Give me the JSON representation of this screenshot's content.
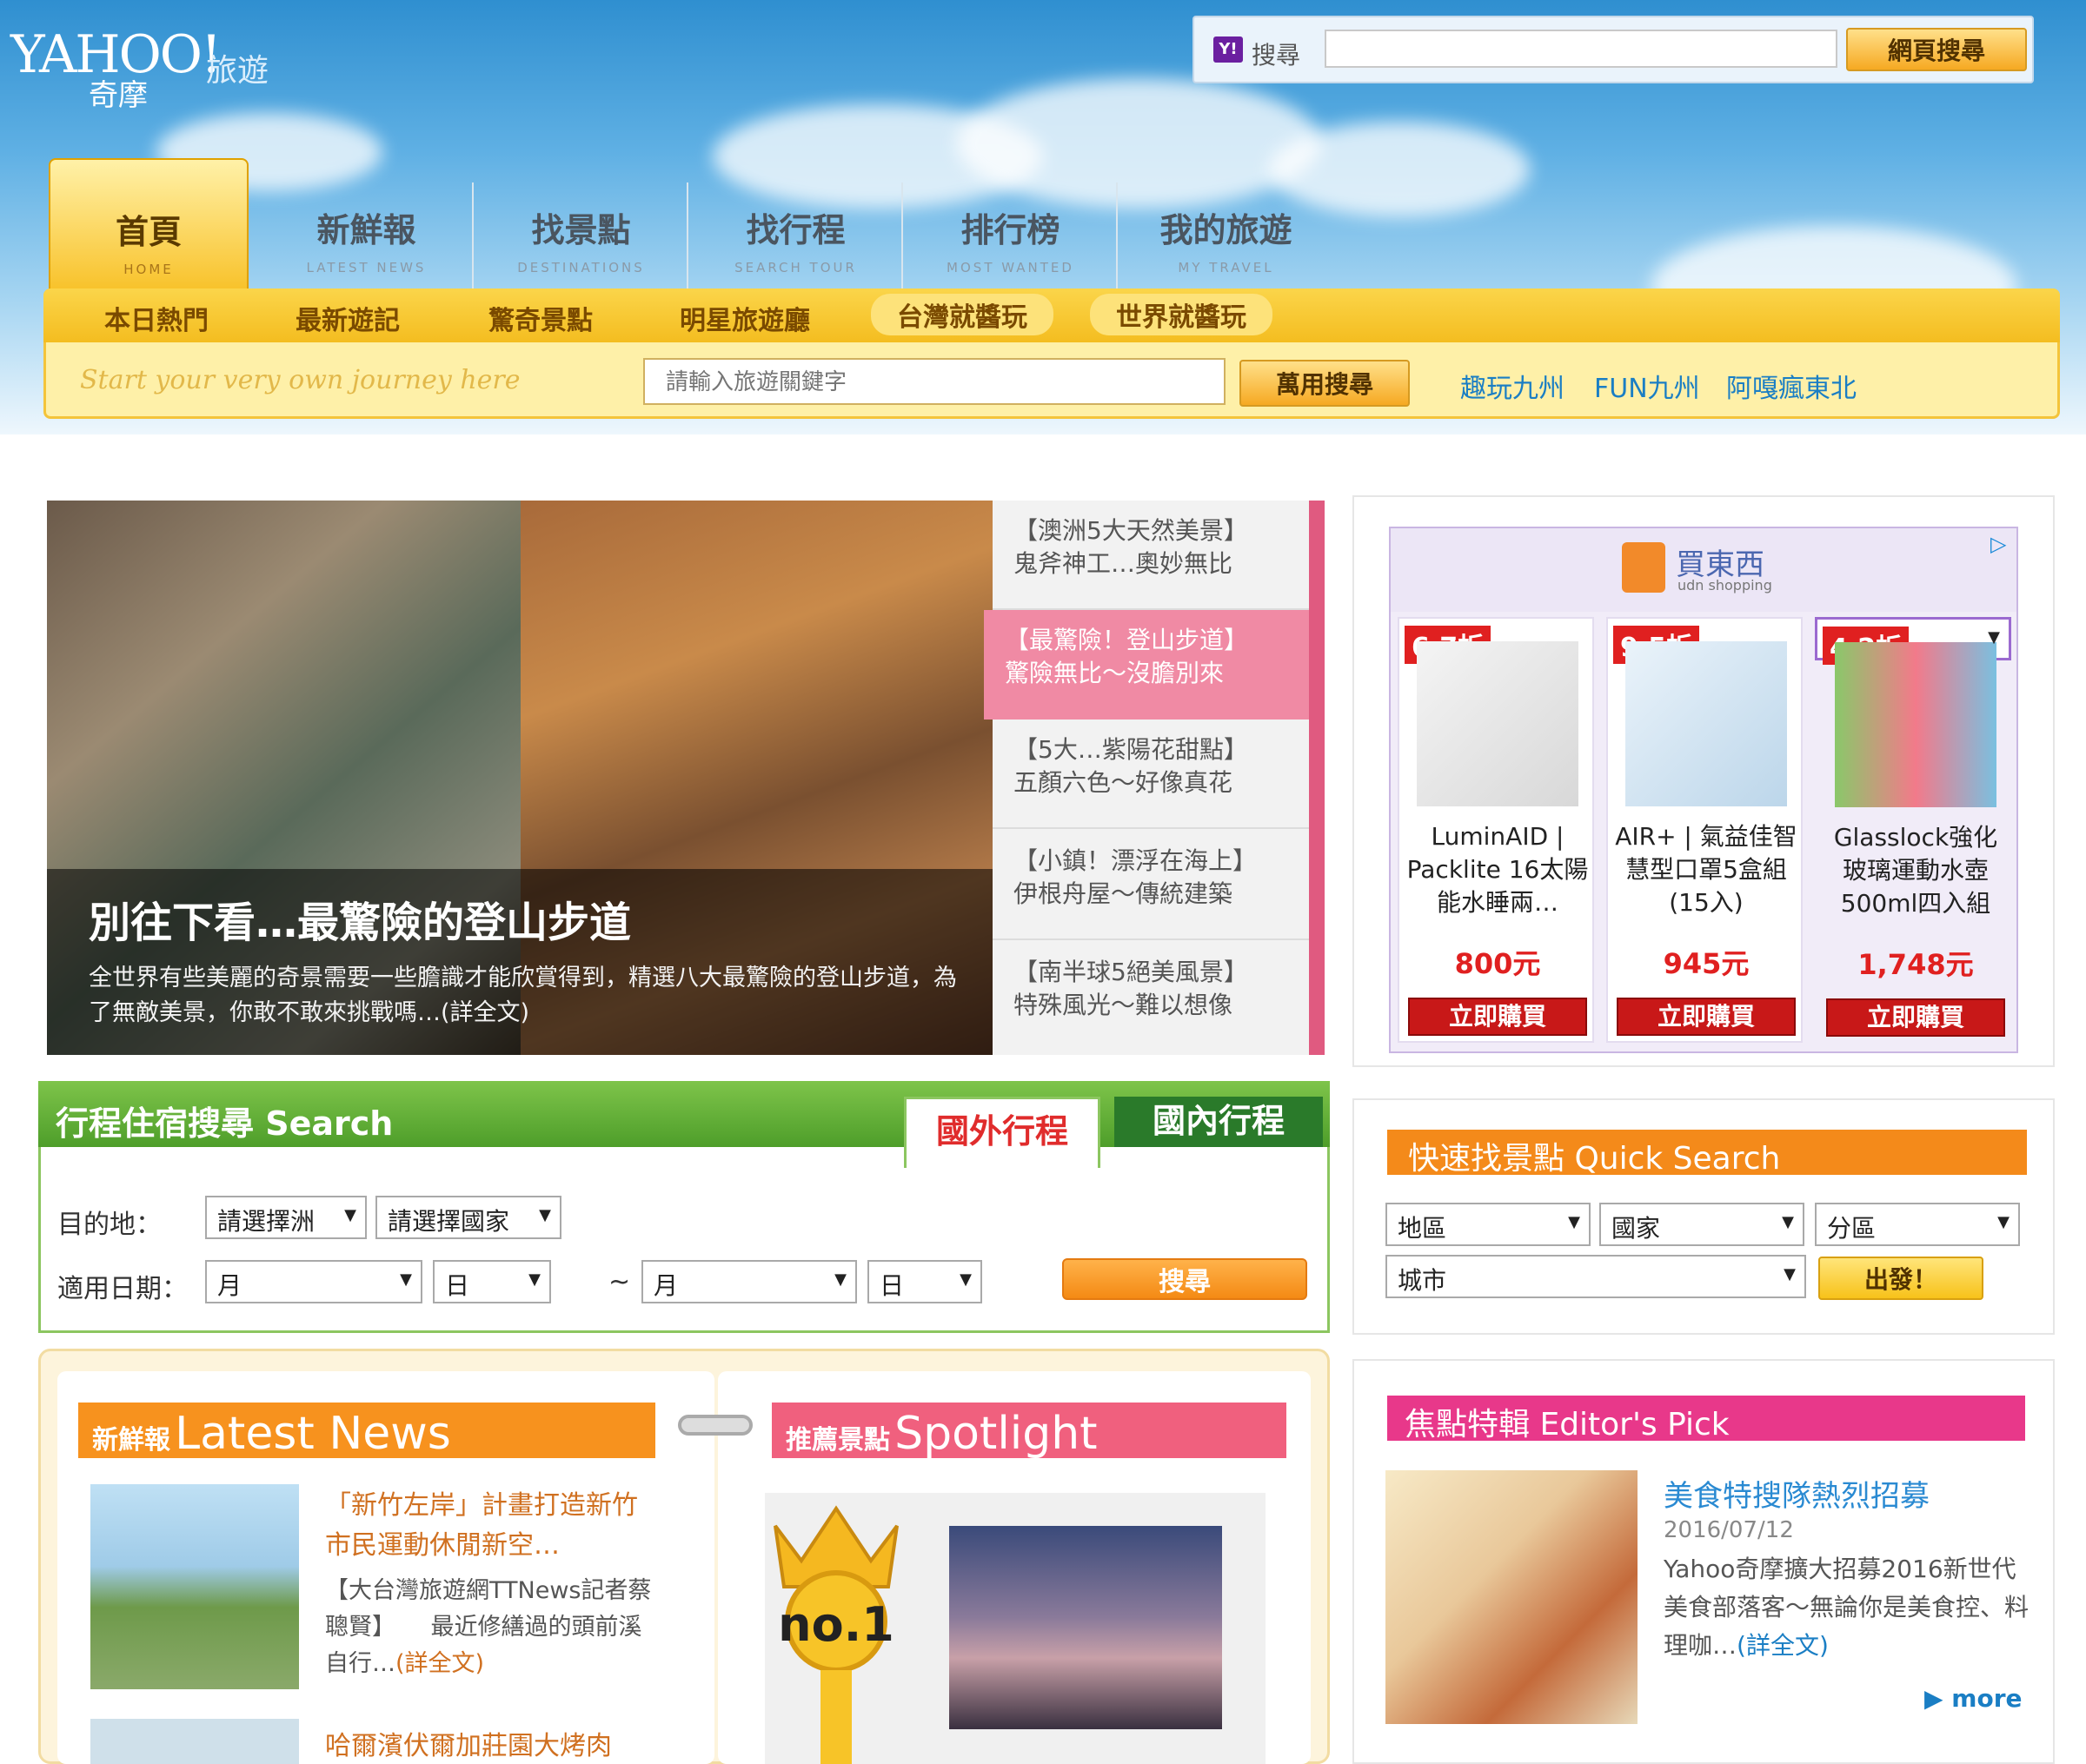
{
  "header": {
    "logo": {
      "brand": "YAHOO!",
      "sub": "奇摩",
      "section": "旅遊"
    },
    "top_search": {
      "label": "搜尋",
      "placeholder": "",
      "button": "網頁搜尋"
    }
  },
  "nav": {
    "tabs": [
      {
        "cn": "首頁",
        "en": "HOME"
      },
      {
        "cn": "新鮮報",
        "en": "LATEST NEWS"
      },
      {
        "cn": "找景點",
        "en": "DESTINATIONS"
      },
      {
        "cn": "找行程",
        "en": "SEARCH TOUR"
      },
      {
        "cn": "排行榜",
        "en": "MOST WANTED"
      },
      {
        "cn": "我的旅遊",
        "en": "MY TRAVEL"
      }
    ],
    "sub": [
      "本日熱門",
      "最新遊記",
      "驚奇景點",
      "明星旅遊廳",
      "台灣就醬玩",
      "世界就醬玩"
    ],
    "slogan": "Start your very own journey here",
    "search_placeholder": "請輸入旅遊關鍵字",
    "search_button": "萬用搜尋",
    "quick_links": [
      "趣玩九州",
      "FUN九州",
      "阿嘎瘋東北"
    ]
  },
  "hero": {
    "title": "別往下看…最驚險的登山步道",
    "desc": "全世界有些美麗的奇景需要一些膽識才能欣賞得到，精選八大最驚險的登山步道，為了無敵美景，你敢不敢來挑戰嗎…",
    "more": "(詳全文)",
    "list": [
      {
        "line1": "【澳洲5大天然美景】",
        "line2": "鬼斧神工…奧妙無比"
      },
      {
        "line1": "【最驚險！登山步道】",
        "line2": "驚險無比～沒膽別來"
      },
      {
        "line1": "【5大…紫陽花甜點】",
        "line2": "五顏六色～好像真花"
      },
      {
        "line1": "【小鎮！漂浮在海上】",
        "line2": "伊根舟屋～傳統建築"
      },
      {
        "line1": "【南半球5絕美風景】",
        "line2": "特殊風光～難以想像"
      }
    ]
  },
  "ad": {
    "brand": "買東西",
    "brand_sub": "udn shopping",
    "items": [
      {
        "discount": "6.7折",
        "name": "LuminAID | Packlite 16太陽能水睡兩…",
        "price": "800元",
        "buy": "立即購買"
      },
      {
        "discount": "9.5折",
        "name": "AIR+ | 氣益佳智慧型口罩5盒組(15入)",
        "price": "945元",
        "buy": "立即購買"
      },
      {
        "discount": "4.2折",
        "name": "Glasslock強化玻璃運動水壺500ml四入組",
        "price": "1,748元",
        "buy": "立即購買"
      }
    ]
  },
  "tour_search": {
    "title": "行程住宿搜尋 Search",
    "tab_intl": "國外行程",
    "tab_dom": "國內行程",
    "dest_label": "目的地：",
    "continent": "請選擇洲",
    "country": "請選擇國家",
    "date_label": "適用日期：",
    "month": "月",
    "day": "日",
    "tilde": "~",
    "button": "搜尋"
  },
  "quick_search": {
    "title": "快速找景點 Quick Search",
    "region": "地區",
    "country": "國家",
    "district": "分區",
    "city": "城市",
    "button": "出發！"
  },
  "news": {
    "title_cn": "新鮮報",
    "title_en": "Latest News",
    "item1_title": "「新竹左岸」計畫打造新竹市民運動休閒新空…",
    "item1_body": "【大台灣旅遊網TTNews記者蔡聰賢】　　最近修繕過的頭前溪自行…",
    "item1_more": "(詳全文)",
    "item2_title": "哈爾濱伏爾加莊園大烤肉"
  },
  "spotlight": {
    "title_cn": "推薦景點",
    "title_en": "Spotlight",
    "badge": "no.1"
  },
  "editor": {
    "title": "焦點特輯 Editor's Pick",
    "headline": "美食特搜隊熱烈招募",
    "date": "2016/07/12",
    "body": "Yahoo奇摩擴大招募2016新世代美食部落客～無論你是美食控、料理咖…",
    "more_link": "(詳全文)",
    "more": "more"
  }
}
